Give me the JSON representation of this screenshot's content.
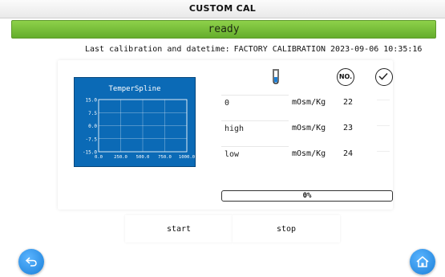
{
  "window": {
    "title": "CUSTOM CAL"
  },
  "status": {
    "text": "ready",
    "color": "#6fbf34"
  },
  "last_calibration": {
    "label": "Last calibration and datetime:",
    "value": "FACTORY CALIBRATION 2023-09-06 10:35:16"
  },
  "chart": {
    "title": "TemperSpline",
    "y_ticks": [
      "15.0",
      "7.5",
      "0.0",
      "-7.5",
      "-15.0"
    ],
    "x_ticks": [
      "0.0",
      "250.0",
      "500.0",
      "750.0",
      "1000.0"
    ]
  },
  "chart_data": {
    "type": "line",
    "title": "TemperSpline",
    "xlabel": "",
    "ylabel": "",
    "xlim": [
      0,
      1000
    ],
    "ylim": [
      -15,
      15
    ],
    "grid": true,
    "series": []
  },
  "header_icons": {
    "vial": "test-tube-icon",
    "number": "NO.",
    "check": "check-circle-icon"
  },
  "rows": [
    {
      "value": "0",
      "unit": "mOsm/Kg",
      "number": "22"
    },
    {
      "value": "high",
      "unit": "mOsm/Kg",
      "number": "23"
    },
    {
      "value": "low",
      "unit": "mOsm/Kg",
      "number": "24"
    }
  ],
  "progress": {
    "label": "0%",
    "value": 0
  },
  "buttons": {
    "start": "start",
    "stop": "stop"
  },
  "nav": {
    "back_icon": "back-arrow-icon",
    "home_icon": "home-icon"
  },
  "colors": {
    "accent_blue": "#1a7fd8",
    "chart_bg": "#0b6ab6",
    "status_green": "#6fbf34"
  }
}
